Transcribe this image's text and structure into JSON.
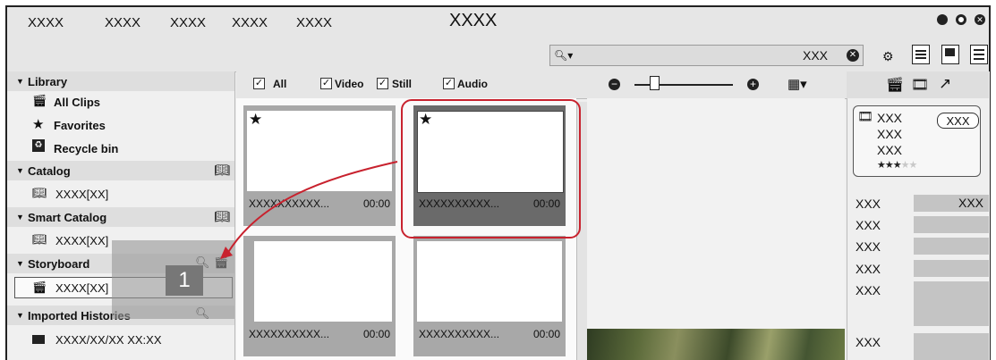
{
  "menu": {
    "items": [
      "XXXX",
      "XXXX",
      "XXXX",
      "XXXX",
      "XXXX"
    ],
    "title": "XXXX"
  },
  "search": {
    "value": "XXX"
  },
  "sidebar": {
    "library": "Library",
    "all_clips": "All Clips",
    "favorites": "Favorites",
    "recycle_bin": "Recycle bin",
    "catalog": "Catalog",
    "catalog_item": "XXXX[XX]",
    "smart_catalog": "Smart Catalog",
    "smart_catalog_item": "XXXX[XX]",
    "storyboard": "Storyboard",
    "storyboard_item": "XXXX[XX]",
    "imported_histories": "Imported Histories",
    "history_item": "XXXX/XX/XX XX:XX"
  },
  "filters": {
    "all": "All",
    "video": "Video",
    "still": "Still",
    "audio": "Audio"
  },
  "zoom": {
    "value": 0.2
  },
  "clips": [
    {
      "name": "XXXXXXXXXX...",
      "time": "00:00",
      "favorite": true,
      "selected": false
    },
    {
      "name": "XXXXXXXXXX...",
      "time": "00:00",
      "favorite": true,
      "selected": true
    },
    {
      "name": "XXXXXXXXXX...",
      "time": "00:00",
      "favorite": false,
      "selected": false
    },
    {
      "name": "XXXXXXXXXX...",
      "time": "00:00",
      "favorite": false,
      "selected": false
    }
  ],
  "properties": {
    "card_lines": [
      "XXX",
      "XXX",
      "XXX"
    ],
    "card_tag": "XXX",
    "rating": 3,
    "rating_max": 5,
    "rows": [
      {
        "label": "XXX",
        "value": "XXX"
      },
      {
        "label": "XXX",
        "value": ""
      },
      {
        "label": "XXX",
        "value": ""
      },
      {
        "label": "XXX",
        "value": ""
      },
      {
        "label": "XXX",
        "value": ""
      },
      {
        "label": "XXX",
        "value": ""
      }
    ]
  },
  "callout": {
    "number": "1"
  },
  "colors": {
    "highlight": "#c8222e",
    "selected_clip": "#6a6a6a"
  },
  "icons": [
    "search-icon",
    "close-icon",
    "gear-icon",
    "star-icon",
    "clapper-icon",
    "catalog-icon",
    "folder-icon",
    "trash-icon",
    "export-icon"
  ]
}
